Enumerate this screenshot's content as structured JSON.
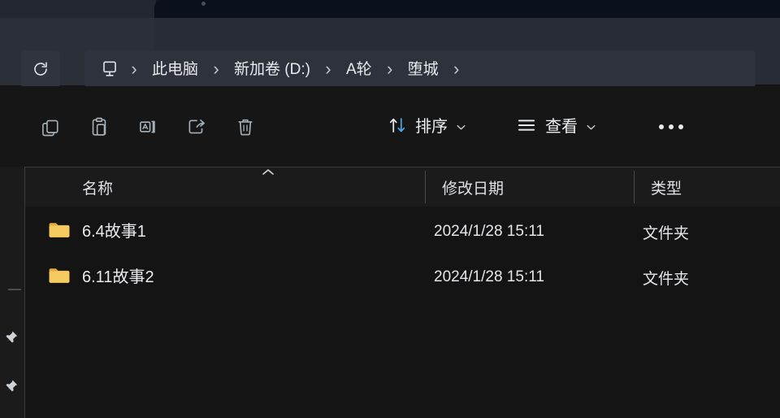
{
  "window": {
    "tabstrip_label": ""
  },
  "addressbar": {
    "refresh_icon": "refresh-icon",
    "this_pc_icon": "this-pc-monitor-icon",
    "separator_glyph": "›",
    "breadcrumbs": [
      {
        "label": "此电脑"
      },
      {
        "label": "新加卷 (D:)"
      },
      {
        "label": "A轮"
      },
      {
        "label": "堕城"
      }
    ]
  },
  "toolbar": {
    "icon_buttons": [
      {
        "name": "copy-button",
        "icon": "copy-icon"
      },
      {
        "name": "paste-button",
        "icon": "paste-icon"
      },
      {
        "name": "rename-button",
        "icon": "rename-icon"
      },
      {
        "name": "share-button",
        "icon": "share-icon"
      },
      {
        "name": "delete-button",
        "icon": "trash-icon"
      }
    ],
    "sort_label": "排序",
    "sort_icon": "sort-arrows-icon",
    "view_label": "查看",
    "view_icon": "view-list-icon",
    "caret_glyph": "ˇ",
    "more_label": "···"
  },
  "columns": {
    "name": "名称",
    "date_modified": "修改日期",
    "type": "类型",
    "sort_indicator": "ascending"
  },
  "files": [
    {
      "name": "6.4故事1",
      "date_modified": "2024/1/28 15:11",
      "type": "文件夹",
      "icon": "folder-icon"
    },
    {
      "name": "6.11故事2",
      "date_modified": "2024/1/28 15:11",
      "type": "文件夹",
      "icon": "folder-icon"
    }
  ],
  "navpane": {
    "items": [
      {
        "icon": "pin-icon"
      },
      {
        "icon": "pin-icon"
      }
    ]
  },
  "colors": {
    "tabstrip_bg": "#0b111c",
    "addressbar_bg": "#282c35",
    "toolbar_bg": "#161616",
    "list_bg": "#141414",
    "header_bg": "#1b1b1b",
    "folder_yellow": "#f0bf4d",
    "text_primary": "#e9eaed",
    "sort_arrow_blue": "#4aa8e8"
  }
}
